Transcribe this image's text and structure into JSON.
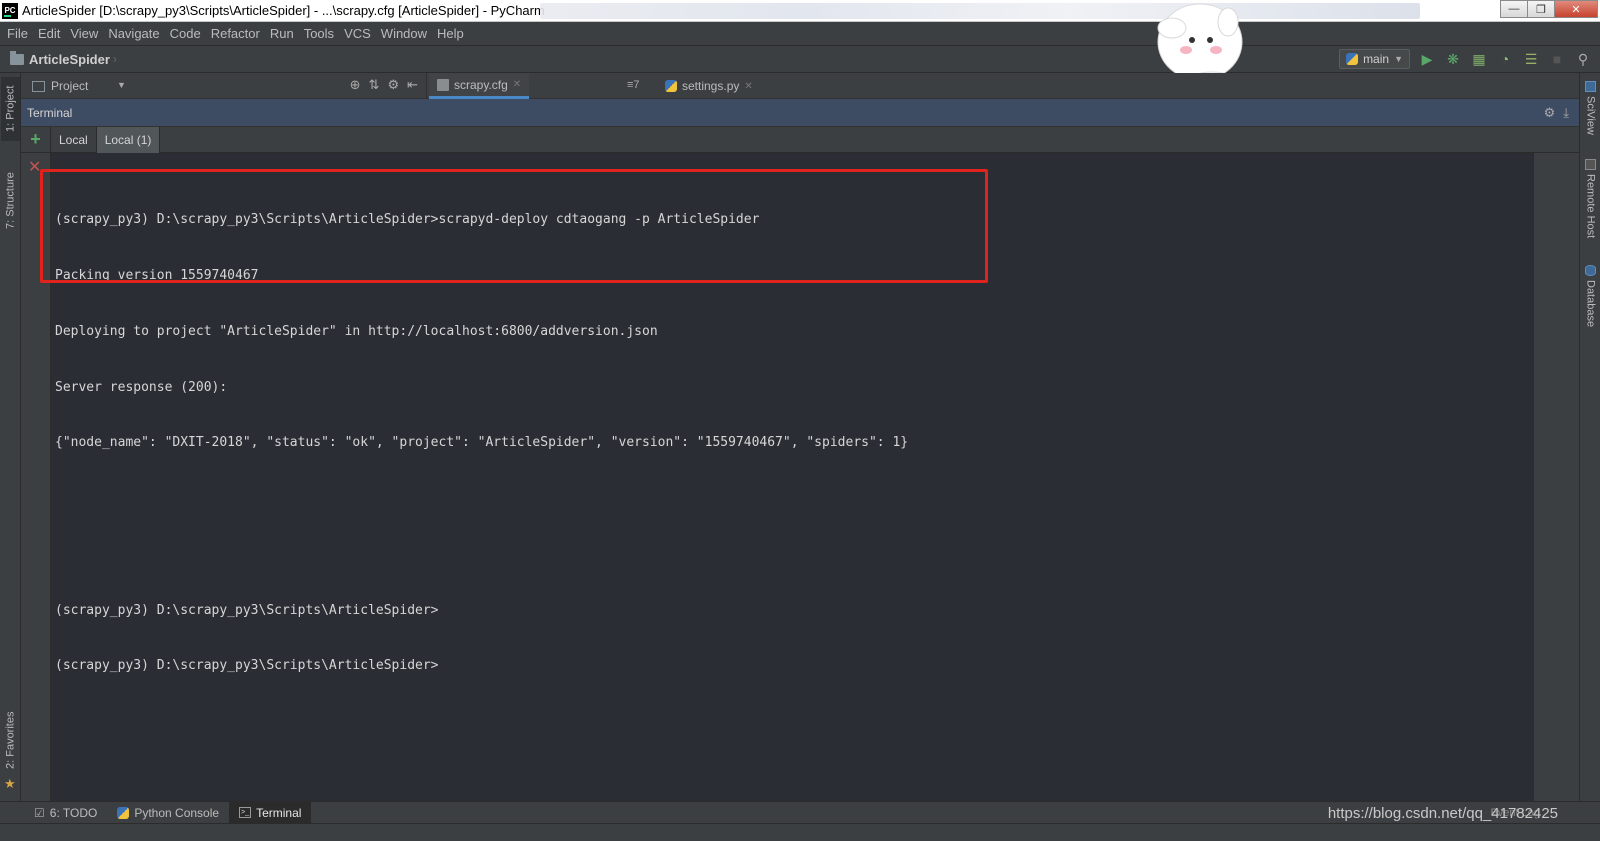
{
  "window": {
    "title": "ArticleSpider [D:\\scrapy_py3\\Scripts\\ArticleSpider] - ...\\scrapy.cfg [ArticleSpider] - PyCharm",
    "logo_text": "PC"
  },
  "menu": [
    "File",
    "Edit",
    "View",
    "Navigate",
    "Code",
    "Refactor",
    "Run",
    "Tools",
    "VCS",
    "Window",
    "Help"
  ],
  "navbar": {
    "project": "ArticleSpider",
    "run_config": "main"
  },
  "left_stripe": {
    "project_tab": "1: Project",
    "structure_tab": "7: Structure",
    "favorites_tab": "2: Favorites"
  },
  "right_stripe": {
    "sciview_tab": "SciView",
    "remote_host_tab": "Remote Host",
    "database_tab": "Database"
  },
  "project_panel": {
    "label": "Project"
  },
  "editor_tabs": [
    {
      "label": "scrapy.cfg",
      "selected": true
    },
    {
      "label": "settings.py",
      "selected": false
    }
  ],
  "editor_split_indicator": "≡7",
  "terminal": {
    "title": "Terminal",
    "tabs": [
      {
        "label": "Local",
        "selected": false
      },
      {
        "label": "Local (1)",
        "selected": true
      }
    ],
    "lines": [
      "(scrapy_py3) D:\\scrapy_py3\\Scripts\\ArticleSpider>scrapyd-deploy cdtaogang -p ArticleSpider",
      "Packing version 1559740467",
      "Deploying to project \"ArticleSpider\" in http://localhost:6800/addversion.json",
      "Server response (200):",
      "{\"node_name\": \"DXIT-2018\", \"status\": \"ok\", \"project\": \"ArticleSpider\", \"version\": \"1559740467\", \"spiders\": 1}",
      "",
      "",
      "(scrapy_py3) D:\\scrapy_py3\\Scripts\\ArticleSpider>",
      "(scrapy_py3) D:\\scrapy_py3\\Scripts\\ArticleSpider>"
    ],
    "highlight_color": "#e0231c"
  },
  "bottom_tabs": [
    {
      "label": "6: TODO",
      "icon": "todo-icon",
      "selected": false
    },
    {
      "label": "Python Console",
      "icon": "python-console-icon",
      "selected": false
    },
    {
      "label": "Terminal",
      "icon": "terminal-icon",
      "selected": true
    }
  ],
  "event_log": "Event Log",
  "watermark": "https://blog.csdn.net/qq_41782425",
  "colors": {
    "accent": "#4a88c7",
    "terminal_bg": "#2b2d34",
    "ide_bg": "#3c3f41",
    "run_green": "#59a869",
    "close_red": "#c75450"
  }
}
